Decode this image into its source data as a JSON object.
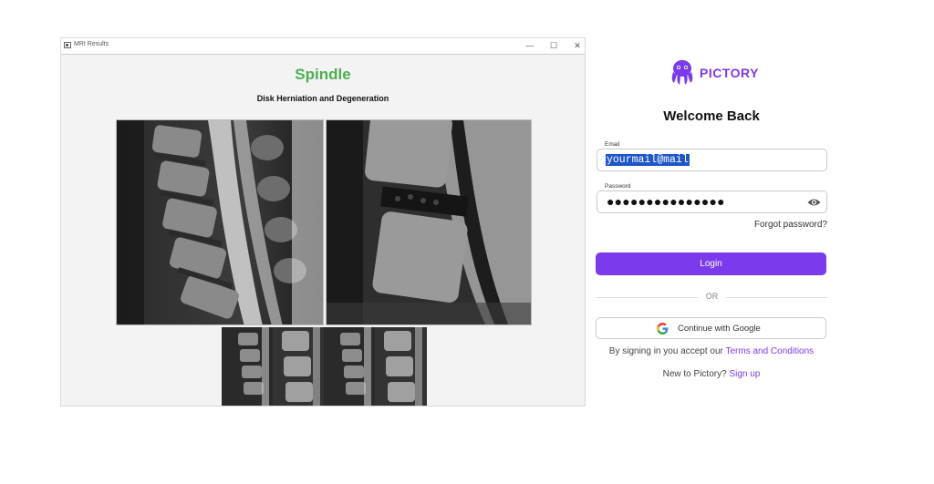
{
  "mri_window": {
    "title": "MRI Results",
    "heading": "Spindle",
    "subheading": "Disk Herniation and Degeneration",
    "controls": {
      "minimize": "—",
      "maximize": "☐",
      "close": "✕"
    },
    "colors": {
      "heading": "#4caf50"
    }
  },
  "login": {
    "brand": "PICTORY",
    "welcome": "Welcome Back",
    "email_label": "Email",
    "email_value": "yourmail@mail",
    "password_label": "Password",
    "password_value": "●●●●●●●●●●●●●●●",
    "forgot": "Forgot password?",
    "login_button": "Login",
    "or_text": "OR",
    "google_button": "Continue with Google",
    "terms_prefix": "By signing in you accept our ",
    "terms_link": "Terms and Conditions",
    "new_prefix": "New to Pictory? ",
    "signup_link": "Sign up",
    "icons": {
      "eye": "eye-icon",
      "google": "google-icon",
      "logo": "octopus-logo"
    },
    "colors": {
      "accent": "#7c3aed",
      "selection": "#1e55c7"
    }
  }
}
